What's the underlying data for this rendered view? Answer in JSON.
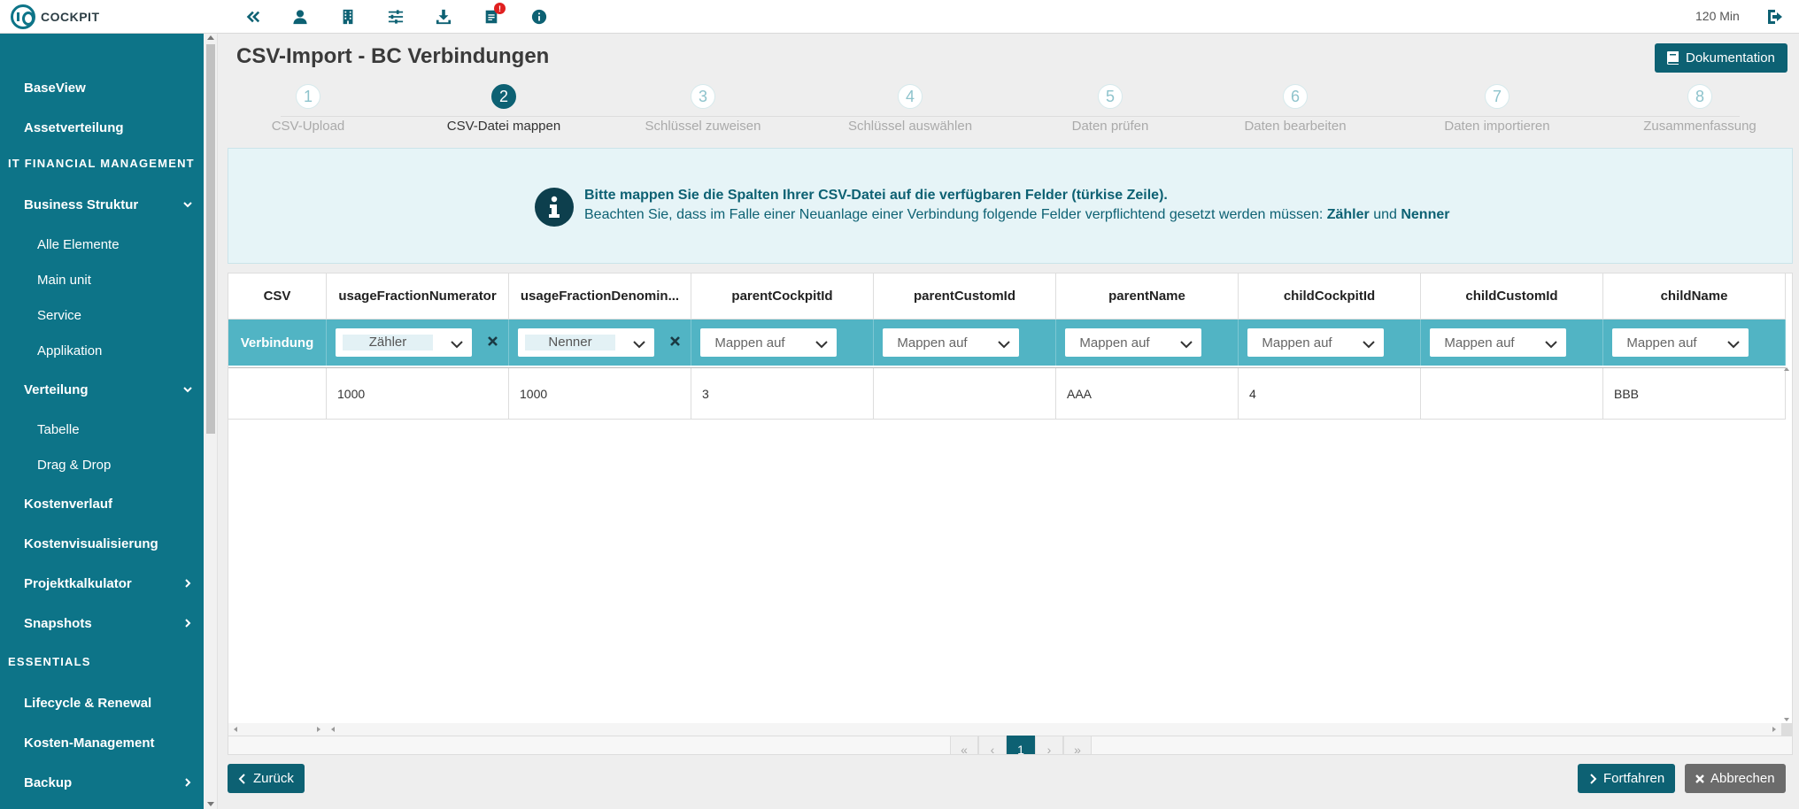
{
  "app": {
    "logo_text": "COCKPIT",
    "session_time": "120 Min",
    "notification_count": "!"
  },
  "toolbar_icons": [
    "collapse-sidebar-icon",
    "user-icon",
    "building-icon",
    "sliders-icon",
    "download-icon",
    "notes-icon",
    "info-icon"
  ],
  "sidebar": {
    "items": [
      {
        "label": "BaseView",
        "type": "item"
      },
      {
        "label": "Assetverteilung",
        "type": "item"
      },
      {
        "label": "IT FINANCIAL MANAGEMENT",
        "type": "section"
      },
      {
        "label": "Business Struktur",
        "type": "item",
        "chevron": "down"
      },
      {
        "label": "Alle Elemente",
        "type": "sub"
      },
      {
        "label": "Main unit",
        "type": "sub"
      },
      {
        "label": "Service",
        "type": "sub"
      },
      {
        "label": "Applikation",
        "type": "sub"
      },
      {
        "label": "Verteilung",
        "type": "item",
        "chevron": "down"
      },
      {
        "label": "Tabelle",
        "type": "sub"
      },
      {
        "label": "Drag & Drop",
        "type": "sub"
      },
      {
        "label": "Kostenverlauf",
        "type": "item"
      },
      {
        "label": "Kostenvisualisierung",
        "type": "item"
      },
      {
        "label": "Projektkalkulator",
        "type": "item",
        "chevron": "right"
      },
      {
        "label": "Snapshots",
        "type": "item",
        "chevron": "right"
      },
      {
        "label": "ESSENTIALS",
        "type": "section"
      },
      {
        "label": "Lifecycle & Renewal",
        "type": "item"
      },
      {
        "label": "Kosten-Management",
        "type": "item"
      },
      {
        "label": "Backup",
        "type": "item",
        "chevron": "right"
      }
    ]
  },
  "page": {
    "title": "CSV-Import - BC Verbindungen",
    "doc_button": "Dokumentation"
  },
  "steps": [
    {
      "num": "1",
      "label": "CSV-Upload"
    },
    {
      "num": "2",
      "label": "CSV-Datei mappen",
      "active": true
    },
    {
      "num": "3",
      "label": "Schlüssel zuweisen"
    },
    {
      "num": "4",
      "label": "Schlüssel auswählen"
    },
    {
      "num": "5",
      "label": "Daten prüfen"
    },
    {
      "num": "6",
      "label": "Daten bearbeiten"
    },
    {
      "num": "7",
      "label": "Daten importieren"
    },
    {
      "num": "8",
      "label": "Zusammenfassung"
    }
  ],
  "info": {
    "line1": "Bitte mappen Sie die Spalten Ihrer CSV-Datei auf die verfügbaren Felder (türkise Zeile).",
    "line2_prefix": "Beachten Sie, dass im Falle einer Neuanlage einer Verbindung folgende Felder verpflichtend gesetzt werden müssen: ",
    "field1": "Zähler",
    "conj": " und ",
    "field2": "Nenner"
  },
  "grid": {
    "columns": [
      "CSV",
      "usageFractionNumerator",
      "usageFractionDenomin...",
      "parentCockpitId",
      "parentCustomId",
      "parentName",
      "childCockpitId",
      "childCustomId",
      "childName"
    ],
    "mapping_row_label": "Verbindung",
    "mappings": [
      "Zähler",
      "Nenner",
      "Mappen auf",
      "Mappen auf",
      "Mappen auf",
      "Mappen auf",
      "Mappen auf",
      "Mappen auf"
    ],
    "rows": [
      [
        "",
        "1000",
        "1000",
        "3",
        "",
        "AAA",
        "4",
        "",
        "BBB"
      ]
    ]
  },
  "pager": {
    "current": "1",
    "first": "«",
    "prev": "‹",
    "next": "›",
    "last": "»"
  },
  "footer": {
    "back": "Zurück",
    "next": "Fortfahren",
    "cancel": "Abbrechen"
  }
}
